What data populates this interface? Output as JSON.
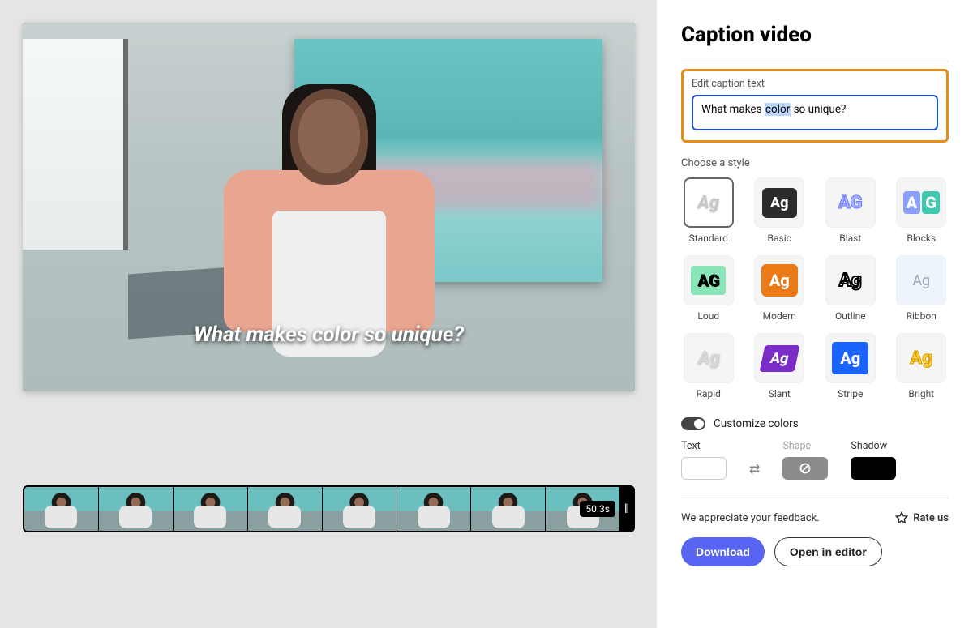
{
  "panel": {
    "title": "Caption video",
    "editLabel": "Edit caption text",
    "captionText": "What makes color so unique?",
    "captionHighlighted": "color",
    "chooseStyleLabel": "Choose a style",
    "customizeLabel": "Customize colors",
    "colorLabels": {
      "text": "Text",
      "shape": "Shape",
      "shadow": "Shadow"
    },
    "feedbackText": "We appreciate your feedback.",
    "rateLabel": "Rate us",
    "downloadLabel": "Download",
    "openEditorLabel": "Open in editor"
  },
  "overlayCaption": "What makes color so unique?",
  "timeline": {
    "duration": "50.3s",
    "thumbCount": 8
  },
  "styles": [
    {
      "id": "standard",
      "name": "Standard",
      "selected": true
    },
    {
      "id": "basic",
      "name": "Basic"
    },
    {
      "id": "blast",
      "name": "Blast"
    },
    {
      "id": "blocks",
      "name": "Blocks"
    },
    {
      "id": "loud",
      "name": "Loud"
    },
    {
      "id": "modern",
      "name": "Modern"
    },
    {
      "id": "outline",
      "name": "Outline"
    },
    {
      "id": "ribbon",
      "name": "Ribbon"
    },
    {
      "id": "rapid",
      "name": "Rapid"
    },
    {
      "id": "slant",
      "name": "Slant"
    },
    {
      "id": "stripe",
      "name": "Stripe"
    },
    {
      "id": "bright",
      "name": "Bright"
    }
  ],
  "colors": {
    "text": "#ffffff",
    "shape": null,
    "shadow": "#000000"
  }
}
